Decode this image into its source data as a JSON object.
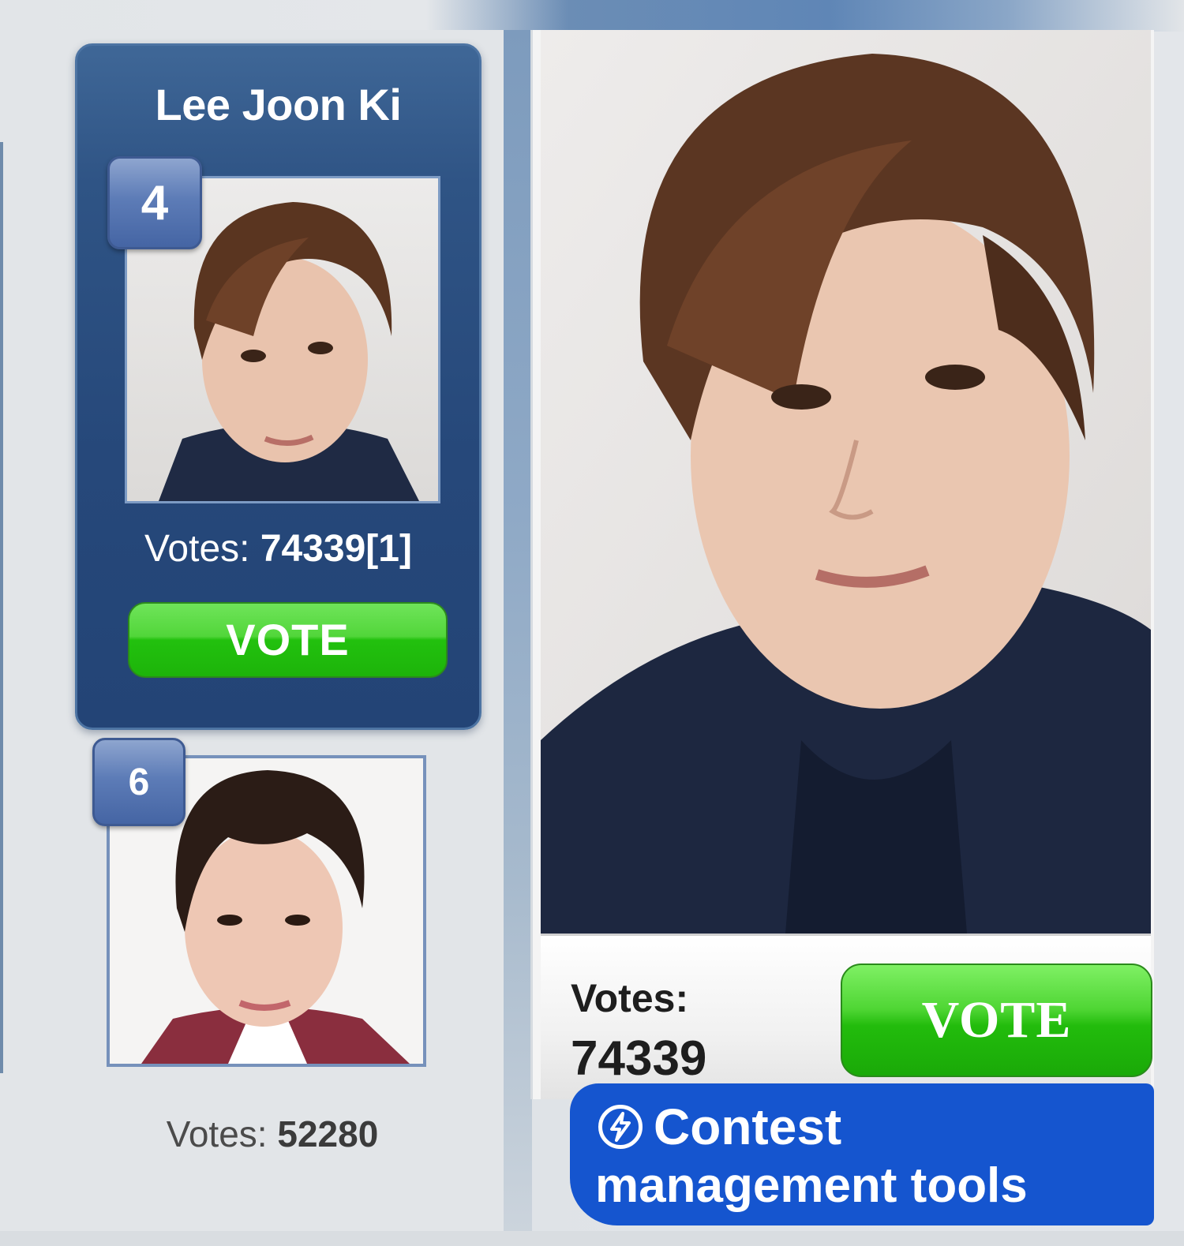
{
  "contestants": [
    {
      "name": "Lee Joon Ki",
      "rank": "4",
      "votes_label": "Votes: ",
      "votes_value": "74339[1]",
      "vote_button": "VOTE"
    },
    {
      "rank": "6",
      "votes_label": "Votes: ",
      "votes_value": "52280"
    }
  ],
  "detail": {
    "votes_label": "Votes:",
    "votes_value": "74339",
    "vote_button": "VOTE"
  },
  "tools": {
    "line1": "Contest",
    "line2": "management tools",
    "icon": "lightning-circle-icon"
  },
  "colors": {
    "card_blue": "#2f5485",
    "vote_green": "#22c10e",
    "tools_blue": "#1555cf"
  }
}
